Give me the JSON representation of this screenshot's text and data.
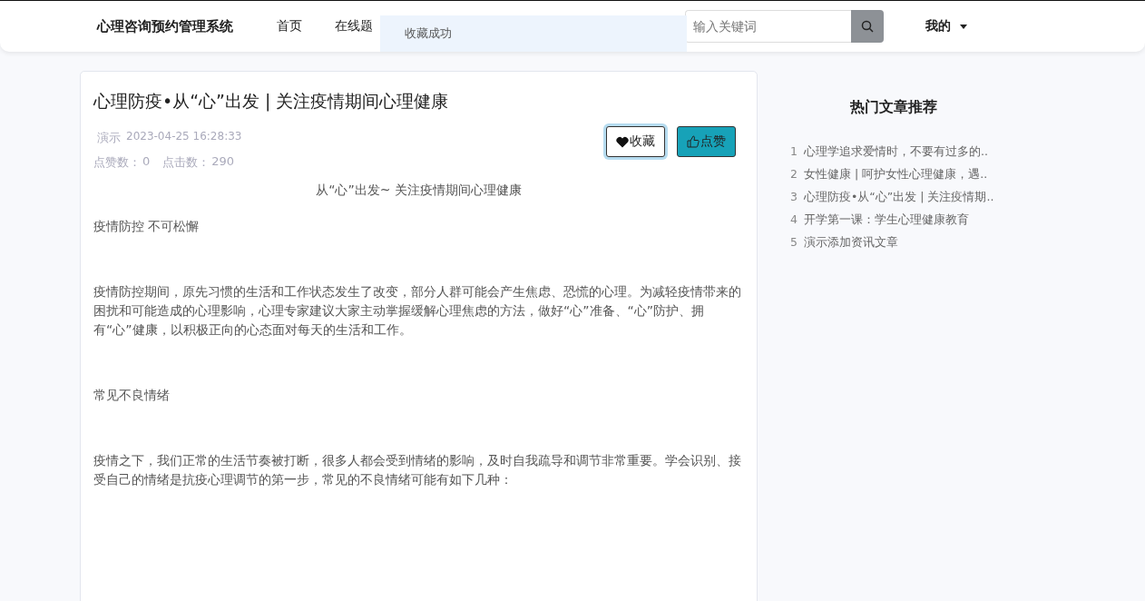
{
  "navbar": {
    "brand": "心理咨询预约管理系统",
    "links": [
      {
        "label": "首页",
        "selected": false
      },
      {
        "label": "在线题",
        "selected": false
      }
    ],
    "search": {
      "placeholder": "输入关键词"
    },
    "user_menu": "我的"
  },
  "toast": {
    "message": "收藏成功"
  },
  "article": {
    "title": "心理防疫•从“心”出发 | 关注疫情期间心理健康",
    "author": "演示",
    "date": "2023-04-25 16:28:33",
    "likes_label": "点赞数：",
    "likes": "0",
    "clicks_label": "点击数：",
    "clicks": "290",
    "buttons": [
      {
        "kind": "favorite",
        "label": "收藏",
        "focused": true
      },
      {
        "kind": "like",
        "label": "点赞",
        "focused": false
      }
    ],
    "subtitle": "从“心”出发~ 关注疫情期间心理健康",
    "paragraphs": [
      "疫情防控 不可松懈",
      "疫情防控期间，原先习惯的生活和工作状态发生了改变，部分人群可能会产生焦虑、恐慌的心理。为减轻疫情带来的困扰和可能造成的心理影响，心理专家建议大家主动掌握缓解心理焦虑的方法，做好“心”准备、“心”防护、拥有“心”健康，以积极正向的心态面对每天的生活和工作。",
      "常见不良情绪",
      "疫情之下，我们正常的生活节奏被打断，很多人都会受到情绪的影响，及时自我疏导和调节非常重要。学会识别、接受自己的情绪是抗疫心理调节的第一步，常见的不良情绪可能有如下几种："
    ]
  },
  "sidebar": {
    "title": "热门文章推荐",
    "items": [
      {
        "rank": "1",
        "title": "心理学追求爱情时，不要有过多的.."
      },
      {
        "rank": "2",
        "title": "女性健康 | 呵护女性心理健康，遇.."
      },
      {
        "rank": "3",
        "title": "心理防疫•从“心”出发 | 关注疫情期.."
      },
      {
        "rank": "4",
        "title": "开学第一课：学生心理健康教育"
      },
      {
        "rank": "5",
        "title": "演示添加资讯文章"
      }
    ]
  }
}
